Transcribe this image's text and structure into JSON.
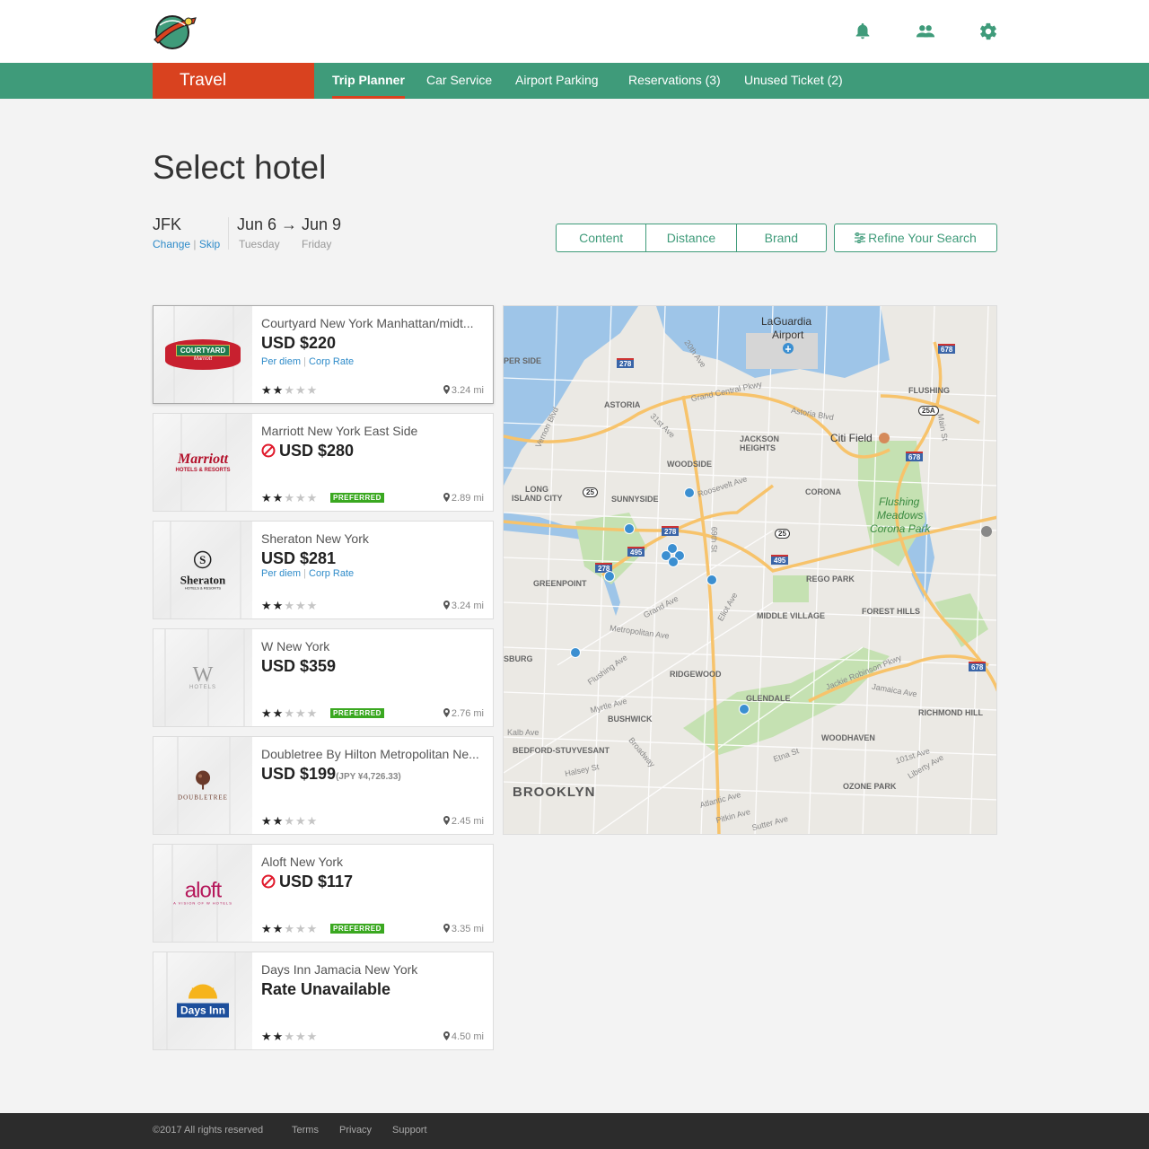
{
  "header": {
    "logo": "Planet Express",
    "icons": [
      "bell-icon",
      "users-icon",
      "gear-icon"
    ],
    "accent_color": "#3f9b7a",
    "brand_color": "#d9421f"
  },
  "nav": {
    "section": "Travel",
    "tabs": [
      {
        "label": "Trip Planner",
        "active": true
      },
      {
        "label": "Car Service",
        "active": false
      },
      {
        "label": "Airport Parking",
        "active": false
      },
      {
        "label": "Reservations (3)",
        "active": false
      },
      {
        "label": "Unused Ticket (2)",
        "active": false
      }
    ]
  },
  "page": {
    "title": "Select hotel",
    "airport": "JFK",
    "change_label": "Change",
    "link_sep": "|",
    "skip_label": "Skip",
    "dates": "Jun 6 → Jun 9",
    "day_from": "Tuesday",
    "day_to": "Friday"
  },
  "filters": {
    "buttons": [
      "Content",
      "Distance",
      "Brand"
    ],
    "refine_label": "Refine Your Search"
  },
  "hotels": [
    {
      "name": "Courtyard New York Manhattan/midt...",
      "price": "USD $220",
      "price_sub": "",
      "policy_blocked": false,
      "rates": [
        "Per diem",
        "Corp Rate"
      ],
      "stars": 2,
      "preferred": false,
      "distance": "3.24 mi",
      "brand": "COURTYARD",
      "brand_sub": "Marriott",
      "selected": true
    },
    {
      "name": "Marriott New York East Side",
      "price": "USD $280",
      "price_sub": "",
      "policy_blocked": true,
      "rates": [],
      "stars": 2,
      "preferred": true,
      "distance": "2.89 mi",
      "brand": "Marriott",
      "brand_sub": "HOTELS & RESORTS",
      "selected": false
    },
    {
      "name": "Sheraton New York",
      "price": "USD $281",
      "price_sub": "",
      "policy_blocked": false,
      "rates": [
        "Per diem",
        "Corp Rate"
      ],
      "stars": 2,
      "preferred": false,
      "distance": "3.24 mi",
      "brand": "Sheraton",
      "brand_sub": "HOTELS & RESORTS",
      "selected": false
    },
    {
      "name": "W New York",
      "price": "USD $359",
      "price_sub": "",
      "policy_blocked": false,
      "rates": [],
      "stars": 2,
      "preferred": true,
      "distance": "2.76 mi",
      "brand": "W",
      "brand_sub": "HOTELS",
      "selected": false
    },
    {
      "name": "Doubletree By Hilton Metropolitan Ne...",
      "price": "USD $199",
      "price_sub": "(JPY ¥4,726.33)",
      "policy_blocked": false,
      "rates": [],
      "stars": 2,
      "preferred": false,
      "distance": "2.45 mi",
      "brand": "DOUBLETREE",
      "brand_sub": "",
      "selected": false
    },
    {
      "name": "Aloft New York",
      "price": "USD $117",
      "price_sub": "",
      "policy_blocked": true,
      "rates": [],
      "stars": 2,
      "preferred": true,
      "distance": "3.35 mi",
      "brand": "aloft",
      "brand_sub": "A VISION OF W HOTELS",
      "selected": false
    },
    {
      "name": "Days Inn Jamacia New York",
      "price": "Rate Unavailable",
      "price_sub": "",
      "policy_blocked": false,
      "rates": [],
      "stars": 2,
      "preferred": false,
      "distance": "4.50 mi",
      "brand": "Days Inn",
      "brand_sub": "",
      "selected": false
    }
  ],
  "preferred_label": "PREFERRED",
  "map": {
    "labels": [
      "LaGuardia",
      "Airport",
      "Citi Field",
      "Flushing",
      "Meadows",
      "Corona Park",
      "BROOKLYN",
      "ASTORIA",
      "JACKSON",
      "HEIGHTS",
      "WOODSIDE",
      "SUNNYSIDE",
      "CORONA",
      "LONG",
      "ISLAND CITY",
      "GREENPOINT",
      "REGO PARK",
      "MIDDLE VILLAGE",
      "FOREST HILLS",
      "RIDGEWOOD",
      "GLENDALE",
      "BUSHWICK",
      "BEDFORD-STUYVESANT",
      "WOODHAVEN",
      "RICHMOND HILL",
      "OZONE PARK",
      "FLUSHING",
      "Grand Central Pkwy",
      "Jackie Robinson Pkwy",
      "Metropolitan Ave",
      "Myrtle Ave",
      "Atlantic Ave",
      "Astoria Blvd",
      "Grand Ave",
      "Flushing Ave",
      "Broadway",
      "Halsey St",
      "Pitkin Ave",
      "Sutter Ave",
      "Liberty Ave",
      "Jamaica Ave",
      "101st Ave",
      "Main St",
      "20th Ave",
      "31st Ave",
      "Vernon Blvd",
      "Eliot Ave",
      "69th St",
      "Kalb Ave",
      "SBURG",
      "Etna St",
      "Roosevelt Ave",
      "PER SIDE"
    ],
    "shields": [
      "278",
      "278",
      "278",
      "495",
      "495",
      "25",
      "25",
      "25A",
      "678",
      "678",
      "678"
    ]
  },
  "footer": {
    "copyright": "©2017 All rights reserved",
    "links": [
      "Terms",
      "Privacy",
      "Support"
    ]
  }
}
